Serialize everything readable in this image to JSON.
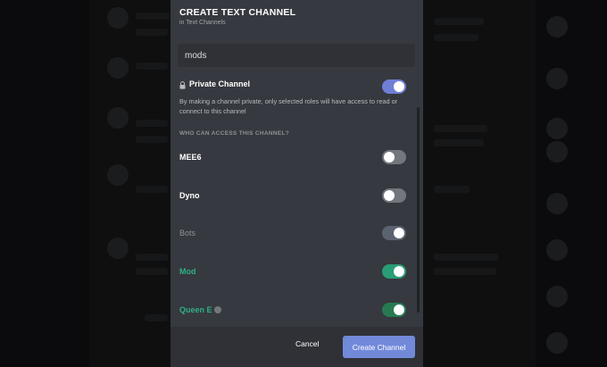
{
  "modal": {
    "title": "CREATE TEXT CHANNEL",
    "subtitle": "in Text Channels",
    "channel_name_value": "mods",
    "private_label": "Private Channel",
    "private_enabled": true,
    "private_description": "By making a channel private, only selected roles will have access to read or connect to this channel",
    "access_heading": "WHO CAN ACCESS THIS CHANNEL?",
    "roles": [
      {
        "label": "MEE6",
        "enabled": false
      },
      {
        "label": "Dyno",
        "enabled": false
      },
      {
        "label": "Bots",
        "enabled": true
      },
      {
        "label": "Mod",
        "enabled": true
      },
      {
        "label": "Queen E",
        "enabled": true
      }
    ],
    "cancel_label": "Cancel",
    "create_label": "Create Channel"
  },
  "colors": {
    "accent": "#7289da",
    "toggle_on_blue": "#6f7fd6",
    "role_green": "#2fb085",
    "modal_bg": "#36393f",
    "footer_bg": "#2f3136"
  },
  "icons": {
    "private": "lock-icon"
  }
}
